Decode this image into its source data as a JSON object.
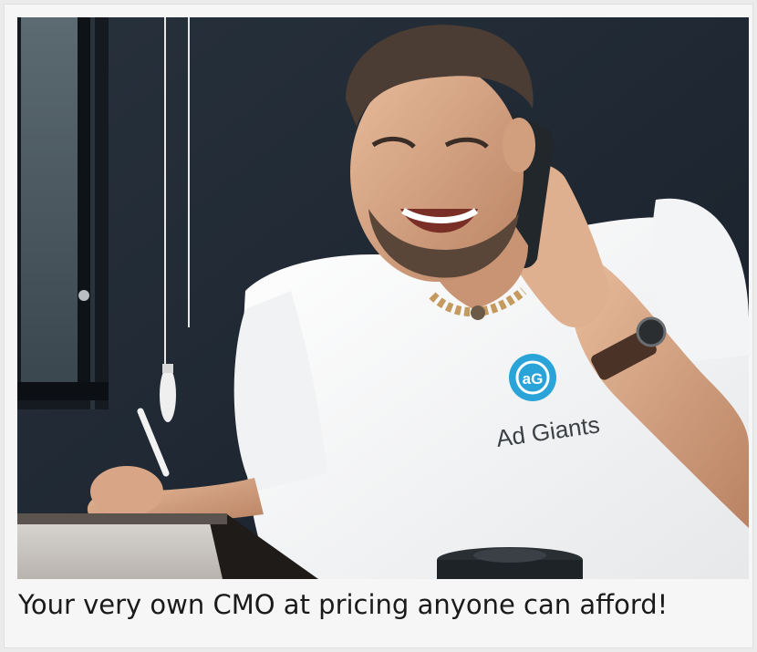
{
  "card": {
    "image_description_icon": "photo-man-on-phone",
    "shirt_logo_text": "Ad Giants",
    "caption": "Your very own CMO at pricing anyone can afford!"
  },
  "colors": {
    "background": "#ebebeb",
    "card": "#f6f6f6",
    "caption_text": "#1a1a1a",
    "logo_blue": "#2aa4d8",
    "wall": "#1d2630"
  }
}
